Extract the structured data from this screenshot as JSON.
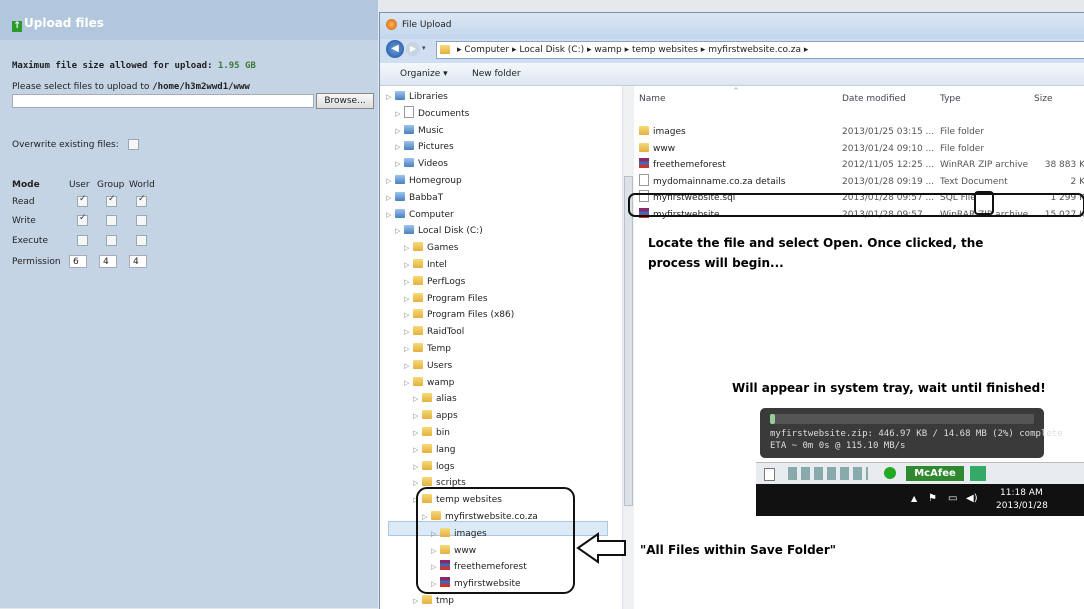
{
  "upload_panel": {
    "title": "Upload files",
    "max_label": "Maximum file size allowed for upload:",
    "max_value": "1.95 GB",
    "select_label": "Please select files to upload to",
    "select_path": "/home/h3m2wwd1/www",
    "browse_label": "Browse...",
    "overwrite_label": "Overwrite existing files:",
    "mode_label": "Mode",
    "col_user": "User",
    "col_group": "Group",
    "col_world": "World",
    "row_read": "Read",
    "row_write": "Write",
    "row_execute": "Execute",
    "row_permission": "Permission",
    "perm_user": "6",
    "perm_group": "4",
    "perm_world": "4"
  },
  "dialog": {
    "title": "File Upload",
    "breadcrumb": [
      "Computer",
      "Local Disk (C:)",
      "wamp",
      "temp websites",
      "myfirstwebsite.co.za"
    ],
    "organize": "Organize ▾",
    "new_folder": "New folder"
  },
  "tree": [
    {
      "label": "Libraries",
      "indent": 1,
      "icon": "library"
    },
    {
      "label": "Documents",
      "indent": 2,
      "icon": "doc"
    },
    {
      "label": "Music",
      "indent": 2,
      "icon": "music"
    },
    {
      "label": "Pictures",
      "indent": 2,
      "icon": "pictures"
    },
    {
      "label": "Videos",
      "indent": 2,
      "icon": "videos"
    },
    {
      "label": "Homegroup",
      "indent": 1,
      "icon": "homegroup"
    },
    {
      "label": "BabbaT",
      "indent": 1,
      "icon": "user"
    },
    {
      "label": "Computer",
      "indent": 1,
      "icon": "computer"
    },
    {
      "label": "Local Disk (C:)",
      "indent": 2,
      "icon": "disk"
    },
    {
      "label": "Games",
      "indent": 3,
      "icon": "folder"
    },
    {
      "label": "Intel",
      "indent": 3,
      "icon": "folder"
    },
    {
      "label": "PerfLogs",
      "indent": 3,
      "icon": "folder"
    },
    {
      "label": "Program Files",
      "indent": 3,
      "icon": "folder"
    },
    {
      "label": "Program Files (x86)",
      "indent": 3,
      "icon": "folder"
    },
    {
      "label": "RaidTool",
      "indent": 3,
      "icon": "folder"
    },
    {
      "label": "Temp",
      "indent": 3,
      "icon": "folder"
    },
    {
      "label": "Users",
      "indent": 3,
      "icon": "folder"
    },
    {
      "label": "wamp",
      "indent": 3,
      "icon": "folder"
    },
    {
      "label": "alias",
      "indent": 4,
      "icon": "folder"
    },
    {
      "label": "apps",
      "indent": 4,
      "icon": "folder"
    },
    {
      "label": "bin",
      "indent": 4,
      "icon": "folder"
    },
    {
      "label": "lang",
      "indent": 4,
      "icon": "folder"
    },
    {
      "label": "logs",
      "indent": 4,
      "icon": "folder"
    },
    {
      "label": "scripts",
      "indent": 4,
      "icon": "folder"
    },
    {
      "label": "temp websites",
      "indent": 4,
      "icon": "folder"
    },
    {
      "label": "myfirstwebsite.co.za",
      "indent": 5,
      "icon": "folder"
    },
    {
      "label": "images",
      "indent": 6,
      "icon": "folder"
    },
    {
      "label": "www",
      "indent": 6,
      "icon": "folder"
    },
    {
      "label": "freethemeforest",
      "indent": 6,
      "icon": "zip"
    },
    {
      "label": "myfirstwebsite",
      "indent": 6,
      "icon": "zip"
    },
    {
      "label": "tmp",
      "indent": 4,
      "icon": "folder"
    }
  ],
  "files_header": {
    "name": "Name",
    "date": "Date modified",
    "type": "Type",
    "size": "Size"
  },
  "files": [
    {
      "name": "images",
      "date": "2013/01/25 03:15 ...",
      "type": "File folder",
      "size": "",
      "icon": "folder"
    },
    {
      "name": "www",
      "date": "2013/01/24 09:10 ...",
      "type": "File folder",
      "size": "",
      "icon": "folder"
    },
    {
      "name": "freethemeforest",
      "date": "2012/11/05 12:25 ...",
      "type": "WinRAR ZIP archive",
      "size": "38 883 K",
      "icon": "zip"
    },
    {
      "name": "mydomainname.co.za details",
      "date": "2013/01/28 09:19 ...",
      "type": "Text Document",
      "size": "2 K",
      "icon": "doc"
    },
    {
      "name": "myfirstwebsite.sql",
      "date": "2013/01/28 09:57 ...",
      "type": "SQL File",
      "size": "1 299 K",
      "icon": "doc"
    },
    {
      "name": "myfirstwebsite",
      "date": "2013/01/28 09:57 ...",
      "type": "WinRAR ZIP archive",
      "size": "15 027 K",
      "icon": "zip"
    }
  ],
  "annotations": {
    "locate_1": "Locate the file and select Open. Once clicked, the",
    "locate_2": "process will begin...",
    "tray": "Will appear in system tray, wait until finished!",
    "all_files": "\"All Files within Save Folder\""
  },
  "tray_popup": {
    "line1": "myfirstwebsite.zip: 446.97 KB / 14.68 MB (2%) complete",
    "line2": "ETA ~ 0m 0s @ 115.10 MB/s",
    "progress": 0.02,
    "mcafee": "McAfee",
    "time": "11:18 AM",
    "date": "2013/01/28"
  }
}
